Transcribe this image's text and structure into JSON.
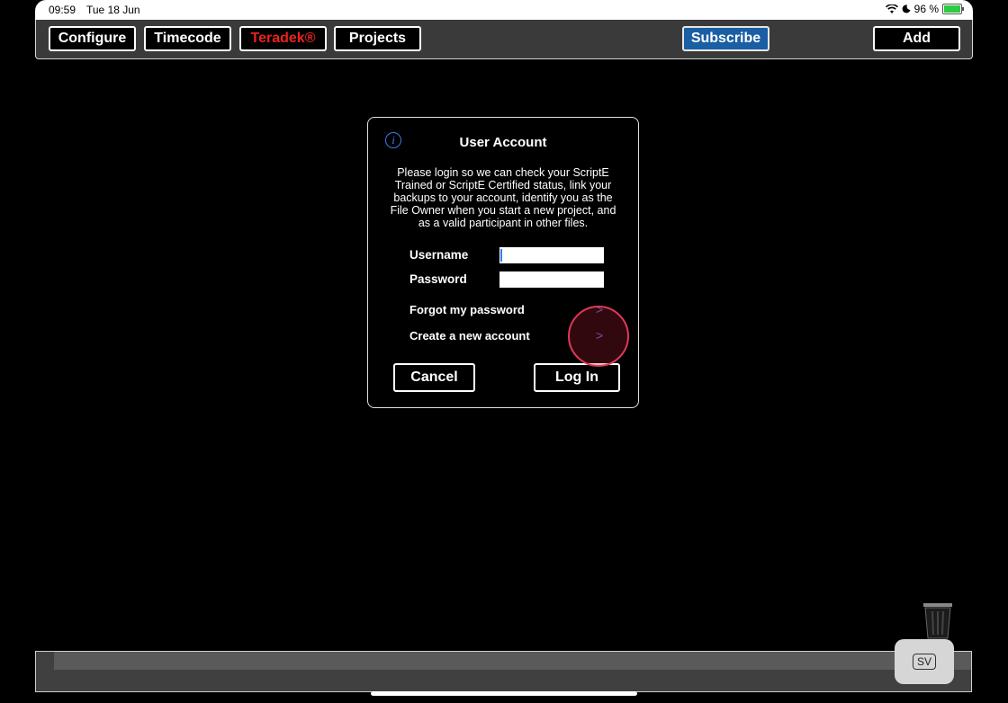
{
  "status_bar": {
    "time": "09:59",
    "date": "Tue 18 Jun",
    "battery_text": "96 %",
    "battery_level": 0.96
  },
  "toolbar": {
    "configure": "Configure",
    "timecode": "Timecode",
    "teradek": "Teradek®",
    "projects": "Projects",
    "subscribe": "Subscribe",
    "add": "Add"
  },
  "dialog": {
    "title": "User Account",
    "message": "Please login so we can check your ScriptE Trained or ScriptE Certified status, link your backups to your account, identify you as the File Owner when you start a new project, and as a valid participant in other files.",
    "username_label": "Username",
    "username_value": "",
    "password_label": "Password",
    "password_value": "",
    "forgot_password": "Forgot my password",
    "create_account": "Create a new account",
    "chevron": ">",
    "cancel": "Cancel",
    "login": "Log In"
  },
  "bottom": {
    "sv_label": "SV"
  },
  "colors": {
    "accent_blue": "#1a5fa3",
    "teradek_red": "#e8231e",
    "chevron_purple": "#5f5ecb"
  }
}
